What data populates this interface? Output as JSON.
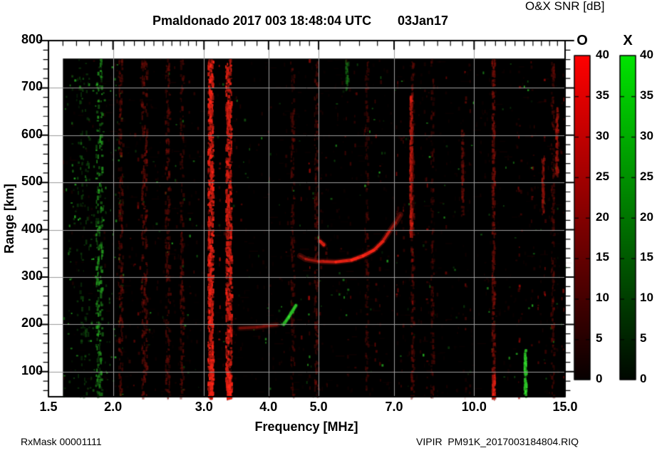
{
  "header": {
    "title": "Pmaldonado 2017 003 18:48:04 UTC",
    "date": "03Jan17",
    "colorbar_title": "O&X SNR [dB]"
  },
  "footer": {
    "left": "RxMask 00001111",
    "right": "VIPIR  PM91K_2017003184804.RIQ"
  },
  "chart_data": {
    "type": "heatmap",
    "title": "Pmaldonado 2017 003 18:48:04 UTC",
    "date_label": "03Jan17",
    "colorbar_title": "O&X SNR [dB]",
    "xlabel": "Frequency [MHz]",
    "ylabel": "Range [km]",
    "x_scale": "log",
    "xlim": [
      1.5,
      15.0
    ],
    "ylim_km": [
      47,
      800
    ],
    "x_ticks": [
      1.5,
      2.0,
      3.0,
      4.0,
      5.0,
      7.0,
      10.0,
      15.0
    ],
    "x_tick_labels": [
      "1.5",
      "2.0",
      "3.0",
      "4.0",
      "5.0",
      "7.0",
      "10.0",
      "15.0"
    ],
    "x_minor_ticks": [
      1.6,
      1.7,
      1.8,
      1.9,
      2.1,
      2.2,
      2.3,
      2.4,
      2.5,
      2.6,
      2.7,
      2.8,
      2.9,
      3.2,
      3.4,
      3.6,
      3.8,
      4.2,
      4.4,
      4.6,
      4.8,
      5.5,
      6.0,
      6.5,
      7.5,
      8.0,
      8.5,
      9.0,
      9.5,
      10.5,
      11.0,
      11.5,
      12.0,
      12.5,
      13.0,
      13.5,
      14.0,
      14.5
    ],
    "y_ticks": [
      100,
      200,
      300,
      400,
      500,
      600,
      700,
      800
    ],
    "y_tick_labels": [
      "100",
      "200",
      "300",
      "400",
      "500",
      "600",
      "700",
      "800"
    ],
    "y_minor_step_km": 20,
    "grid": true,
    "grid_color": "#9c9c9c",
    "plot_background": "#000000",
    "coverage": {
      "f_mhz": [
        1.6,
        15.0
      ],
      "km": [
        47,
        762
      ]
    },
    "colorbars": [
      {
        "label": "O",
        "mode": "ordinary",
        "range": [
          0,
          40
        ],
        "ticks": [
          0,
          5,
          10,
          15,
          20,
          25,
          30,
          35,
          40
        ],
        "top_color": "#ff0000",
        "bottom_color": "#070000"
      },
      {
        "label": "X",
        "mode": "extraordinary",
        "range": [
          0,
          40
        ],
        "ticks": [
          0,
          5,
          10,
          15,
          20,
          25,
          30,
          35,
          40
        ],
        "top_color": "#00e400",
        "bottom_color": "#000700"
      }
    ],
    "interference_lines": [
      {
        "f_mhz": 1.75,
        "km_range": [
          47,
          762
        ],
        "pol": "X",
        "snr_db": 8,
        "spread": 18,
        "style": "speckle"
      },
      {
        "f_mhz": 1.88,
        "km_range": [
          47,
          762
        ],
        "pol": "X",
        "snr_db": 20,
        "spread": 9,
        "style": "speckle"
      },
      {
        "f_mhz": 2.07,
        "km_range": [
          47,
          762
        ],
        "pol": "O",
        "snr_db": 9,
        "spread": 6
      },
      {
        "f_mhz": 2.3,
        "km_range": [
          47,
          762
        ],
        "pol": "O",
        "snr_db": 11,
        "spread": 8
      },
      {
        "f_mhz": 2.55,
        "km_range": [
          47,
          762
        ],
        "pol": "O",
        "snr_db": 9,
        "spread": 6
      },
      {
        "f_mhz": 2.72,
        "km_range": [
          47,
          762
        ],
        "pol": "O",
        "snr_db": 8,
        "spread": 5
      },
      {
        "f_mhz": 3.09,
        "km_range": [
          47,
          762
        ],
        "pol": "O",
        "snr_db": 34,
        "spread": 7
      },
      {
        "f_mhz": 3.1,
        "km_range": [
          47,
          130
        ],
        "pol": "O",
        "snr_db": 40,
        "spread": 5
      },
      {
        "f_mhz": 3.35,
        "km_range": [
          47,
          762
        ],
        "pol": "O",
        "snr_db": 30,
        "spread": 8
      },
      {
        "f_mhz": 3.35,
        "km_range": [
          47,
          100
        ],
        "pol": "O",
        "snr_db": 38,
        "spread": 5
      },
      {
        "f_mhz": 4.45,
        "km_range": [
          47,
          762
        ],
        "pol": "O",
        "snr_db": 7,
        "spread": 5
      },
      {
        "f_mhz": 4.95,
        "km_range": [
          47,
          762
        ],
        "pol": "O",
        "snr_db": 8,
        "spread": 5
      },
      {
        "f_mhz": 5.67,
        "km_range": [
          700,
          760
        ],
        "pol": "X",
        "snr_db": 14,
        "spread": 3
      },
      {
        "f_mhz": 6.2,
        "km_range": [
          47,
          762
        ],
        "pol": "O",
        "snr_db": 6,
        "spread": 4
      },
      {
        "f_mhz": 7.55,
        "km_range": [
          390,
          690
        ],
        "pol": "O",
        "snr_db": 26,
        "spread": 3
      },
      {
        "f_mhz": 7.6,
        "km_range": [
          47,
          762
        ],
        "pol": "O",
        "snr_db": 8,
        "spread": 4
      },
      {
        "f_mhz": 8.3,
        "km_range": [
          47,
          762
        ],
        "pol": "O",
        "snr_db": 6,
        "spread": 4
      },
      {
        "f_mhz": 9.5,
        "km_range": [
          430,
          620
        ],
        "pol": "O",
        "snr_db": 11,
        "spread": 3
      },
      {
        "f_mhz": 10.9,
        "km_range": [
          47,
          762
        ],
        "pol": "O",
        "snr_db": 13,
        "spread": 4
      },
      {
        "f_mhz": 10.9,
        "km_range": [
          47,
          95
        ],
        "pol": "O",
        "snr_db": 30,
        "spread": 3
      },
      {
        "f_mhz": 12.56,
        "km_range": [
          50,
          148
        ],
        "pol": "X",
        "snr_db": 28,
        "spread": 3
      },
      {
        "f_mhz": 13.6,
        "km_range": [
          434,
          555
        ],
        "pol": "O",
        "snr_db": 17,
        "spread": 3
      },
      {
        "f_mhz": 14.45,
        "km_range": [
          520,
          660
        ],
        "pol": "O",
        "snr_db": 19,
        "spread": 3
      },
      {
        "f_mhz": 14.2,
        "km_range": [
          47,
          762
        ],
        "pol": "O",
        "snr_db": 7,
        "spread": 4
      }
    ],
    "echo_traces": [
      {
        "name": "F-layer O-mode arc",
        "pol": "O",
        "snr_db": 30,
        "points": [
          [
            4.6,
            345
          ],
          [
            4.72,
            338
          ],
          [
            5.0,
            333
          ],
          [
            5.4,
            332
          ],
          [
            5.8,
            336
          ],
          [
            6.1,
            345
          ],
          [
            6.4,
            357
          ],
          [
            6.65,
            375
          ],
          [
            6.85,
            396
          ],
          [
            7.05,
            415
          ],
          [
            7.2,
            432
          ]
        ]
      },
      {
        "name": "F-layer blob",
        "pol": "O",
        "snr_db": 24,
        "points": [
          [
            5.03,
            376
          ],
          [
            5.12,
            368
          ]
        ]
      },
      {
        "name": "E-layer faint",
        "pol": "O",
        "snr_db": 9,
        "points": [
          [
            3.52,
            192
          ],
          [
            3.8,
            194
          ],
          [
            4.15,
            199
          ]
        ]
      },
      {
        "name": "E-layer X-mode streak",
        "pol": "X",
        "snr_db": 30,
        "points": [
          [
            4.28,
            200
          ],
          [
            4.38,
            216
          ],
          [
            4.52,
            240
          ]
        ]
      }
    ]
  }
}
